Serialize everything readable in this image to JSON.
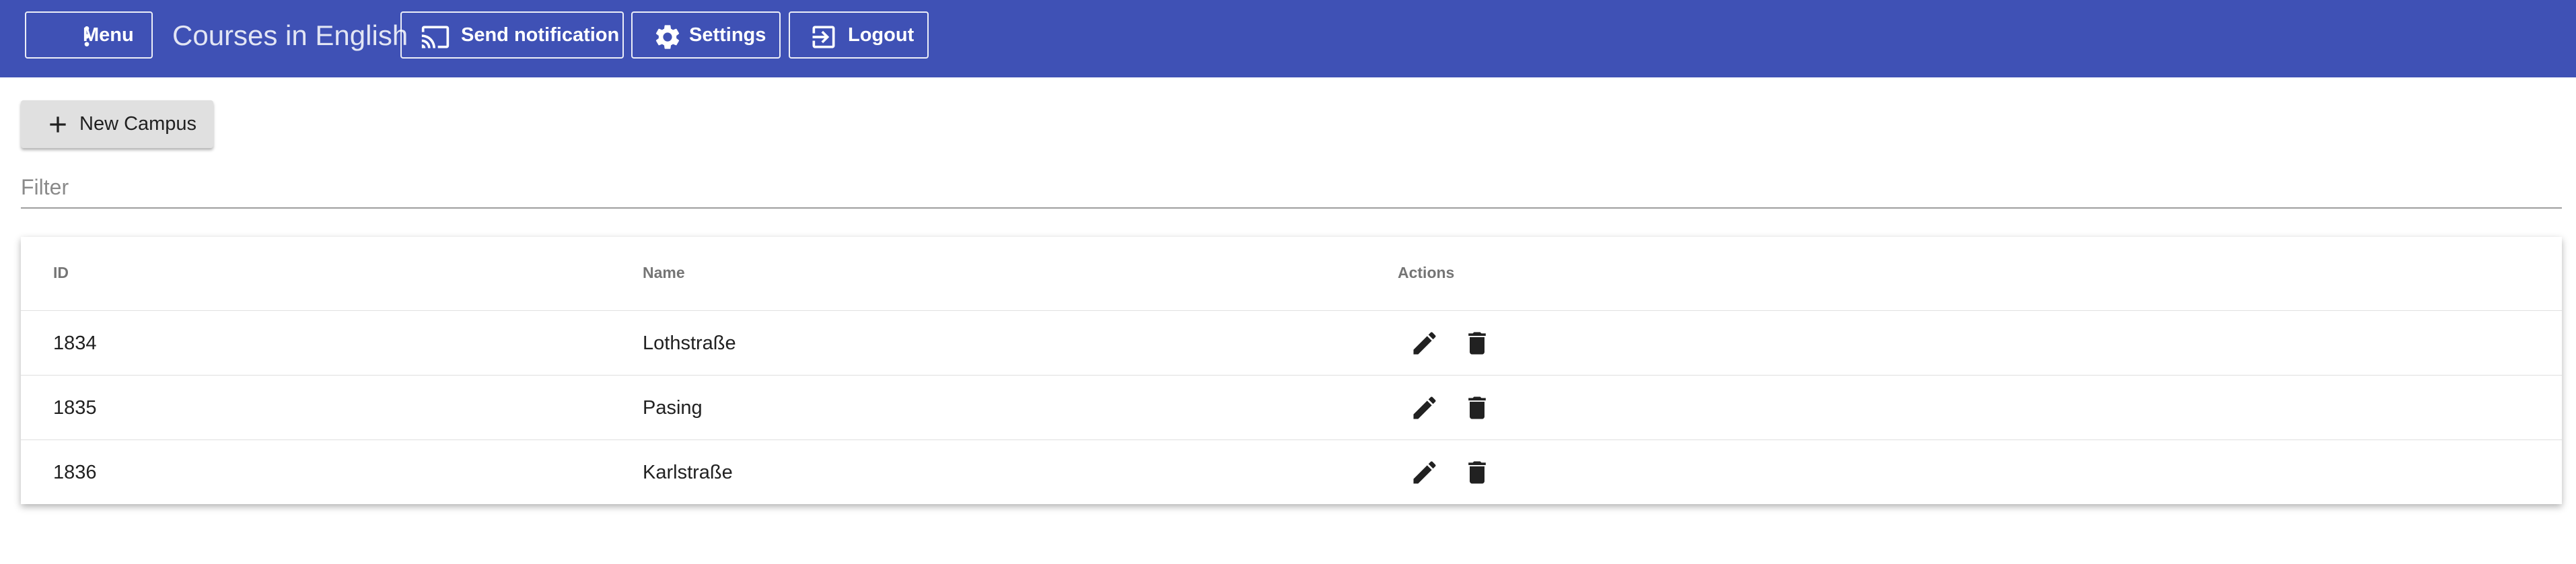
{
  "topbar": {
    "menu_label": "Menu",
    "title": "Courses in English",
    "send_notification_label": "Send notification",
    "settings_label": "Settings",
    "logout_label": "Logout",
    "background_color": "#3f51b5"
  },
  "toolbar": {
    "new_campus_label": "New Campus"
  },
  "filter": {
    "placeholder": "Filter",
    "value": ""
  },
  "table": {
    "headers": {
      "id": "ID",
      "name": "Name",
      "actions": "Actions"
    },
    "rows": [
      {
        "id": "1834",
        "name": "Lothstraße"
      },
      {
        "id": "1835",
        "name": "Pasing"
      },
      {
        "id": "1836",
        "name": "Karlstraße"
      }
    ]
  },
  "icons": {
    "menu": "more-vert-icon",
    "send_notification": "cast-icon",
    "settings": "gear-icon",
    "logout": "exit-icon",
    "new_campus": "plus-icon",
    "edit": "pencil-icon",
    "delete": "trash-icon"
  }
}
